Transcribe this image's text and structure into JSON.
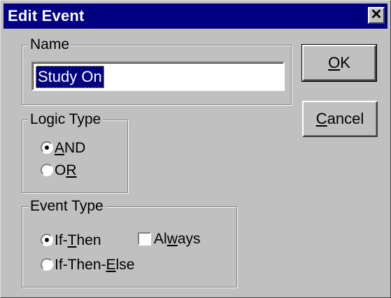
{
  "window": {
    "title": "Edit Event",
    "close_glyph": "✕"
  },
  "name_group": {
    "label": "Name",
    "value": "Study On"
  },
  "logic_type": {
    "label": "Logic Type",
    "options": [
      {
        "pre": "",
        "mnemonic": "A",
        "post": "ND",
        "full": "AND",
        "checked": true
      },
      {
        "pre": "O",
        "mnemonic": "R",
        "post": "",
        "full": "OR",
        "checked": false
      }
    ]
  },
  "event_type": {
    "label": "Event Type",
    "options": [
      {
        "pre": "If-",
        "mnemonic": "T",
        "post": "hen",
        "full": "If-Then",
        "checked": true
      },
      {
        "pre": "If-Then-",
        "mnemonic": "E",
        "post": "lse",
        "full": "If-Then-Else",
        "checked": false
      }
    ],
    "always": {
      "pre": "Al",
      "mnemonic": "w",
      "post": "ays",
      "full": "Always",
      "checked": false
    }
  },
  "buttons": {
    "ok": {
      "mnemonic": "O",
      "post": "K",
      "full": "OK"
    },
    "cancel": {
      "mnemonic": "C",
      "post": "ancel",
      "full": "Cancel"
    }
  },
  "colors": {
    "titlebar": "#000080",
    "face": "#c0c0c0",
    "selection": "#000080"
  },
  "icons": {
    "close": "close-icon",
    "radio": "radio-icon",
    "checkbox": "checkbox-icon"
  }
}
